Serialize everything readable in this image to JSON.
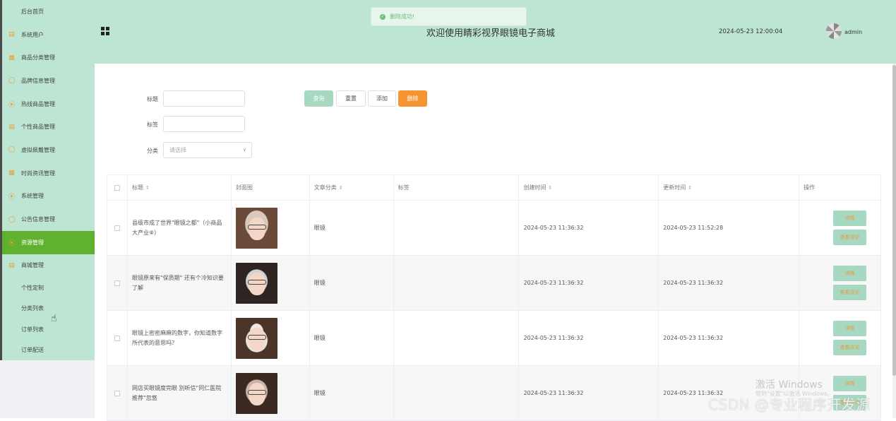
{
  "sidebar": {
    "items": [
      {
        "label": "后台首页",
        "icon": "none"
      },
      {
        "label": "系统用户",
        "icon": "document-icon"
      },
      {
        "label": "商品分类管理",
        "icon": "bar-chart-icon"
      },
      {
        "label": "品牌信息管理",
        "icon": "chat-icon"
      },
      {
        "label": "热线商品管理",
        "icon": "compass-icon"
      },
      {
        "label": "个性商品管理",
        "icon": "document-icon"
      },
      {
        "label": "虚拟佩戴管理",
        "icon": "chat-icon"
      },
      {
        "label": "时尚资讯管理",
        "icon": "bar-chart-icon"
      },
      {
        "label": "系统管理",
        "icon": "compass-icon"
      },
      {
        "label": "公告信息管理",
        "icon": "chat-icon"
      },
      {
        "label": "资源管理",
        "icon": "compass-icon"
      },
      {
        "label": "商城管理",
        "icon": "document-icon"
      }
    ],
    "sub_items": [
      "个性定制",
      "分类列表",
      "订单列表",
      "订单配送"
    ],
    "active_index": 10,
    "active_color": "#5fb130"
  },
  "header": {
    "title": "欢迎使用睛彩视界眼镜电子商城",
    "datetime": "2024-05-23 12:00:04",
    "username": "admin",
    "bg_color": "#bde5d4"
  },
  "toast": {
    "message": "删除成功!"
  },
  "filters": {
    "title_label": "标题",
    "tag_label": "标签",
    "category_label": "分类",
    "category_placeholder": "请选择"
  },
  "buttons": {
    "query": "查询",
    "reset": "重置",
    "add": "添加",
    "delete": "删除"
  },
  "table": {
    "columns": [
      "标题",
      "封面图",
      "文章分类",
      "标签",
      "创建时间",
      "更新时间",
      "操作"
    ],
    "rows": [
      {
        "title": "县级市成了世界\"眼镜之都\"（小商品大产业⑧）",
        "category": "眼镜",
        "tag": "",
        "created": "2024-05-23 11:36:32",
        "updated": "2024-05-23 11:52:28"
      },
      {
        "title": "眼镜原来有\"保质期\" 还有个冷知识要了解",
        "category": "眼镜",
        "tag": "",
        "created": "2024-05-23 11:36:32",
        "updated": "2024-05-23 11:36:32"
      },
      {
        "title": "眼镜上密密麻麻的数字，你知道数字所代表的意思吗？",
        "category": "眼镜",
        "tag": "",
        "created": "2024-05-23 11:36:32",
        "updated": "2024-05-23 11:36:32"
      },
      {
        "title": "网店买眼镜度完眼 別听信\"同仁医院推荐\"忽悠",
        "category": "眼镜",
        "tag": "",
        "created": "2024-05-23 11:36:32",
        "updated": "2024-05-23 11:36:32"
      }
    ],
    "action_detail": "详情",
    "action_comments": "查看评论"
  },
  "watermark": {
    "windows_line1": "激活 Windows",
    "windows_line2": "转到\"设置\"以激活 Windows。",
    "csdn": "CSDN @专业程序开发源"
  }
}
